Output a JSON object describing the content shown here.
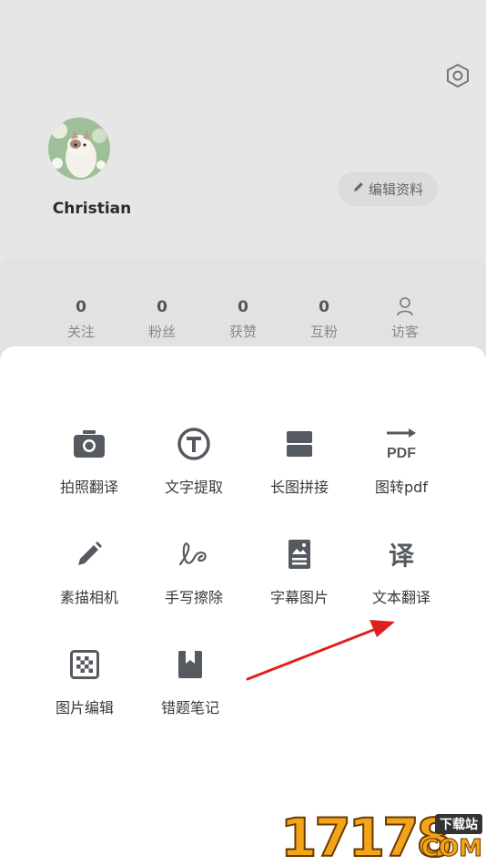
{
  "profile": {
    "username": "Christian",
    "edit_label": "编辑资料"
  },
  "stats": [
    {
      "value": "0",
      "label": "关注"
    },
    {
      "value": "0",
      "label": "粉丝"
    },
    {
      "value": "0",
      "label": "获赞"
    },
    {
      "value": "0",
      "label": "互粉"
    },
    {
      "value": "",
      "label": "访客"
    }
  ],
  "tools": [
    {
      "label": "拍照翻译",
      "icon": "camera-icon"
    },
    {
      "label": "文字提取",
      "icon": "text-t-icon"
    },
    {
      "label": "长图拼接",
      "icon": "stack-icon"
    },
    {
      "label": "图转pdf",
      "icon": "pdf-icon"
    },
    {
      "label": "素描相机",
      "icon": "pencil-icon"
    },
    {
      "label": "手写擦除",
      "icon": "handwriting-icon"
    },
    {
      "label": "字幕图片",
      "icon": "subtitle-image-icon"
    },
    {
      "label": "文本翻译",
      "icon": "translate-icon"
    },
    {
      "label": "图片编辑",
      "icon": "mosaic-icon"
    },
    {
      "label": "错题笔记",
      "icon": "bookmark-icon"
    }
  ],
  "icons": {
    "pdf_text": "PDF",
    "translate_char": "译"
  },
  "watermark": {
    "digits": "17178",
    "tag": "下载站",
    "domain": "COM"
  },
  "colors": {
    "icon": "#555a60",
    "arrow": "#e0201e",
    "accent": "#f2a51c"
  }
}
